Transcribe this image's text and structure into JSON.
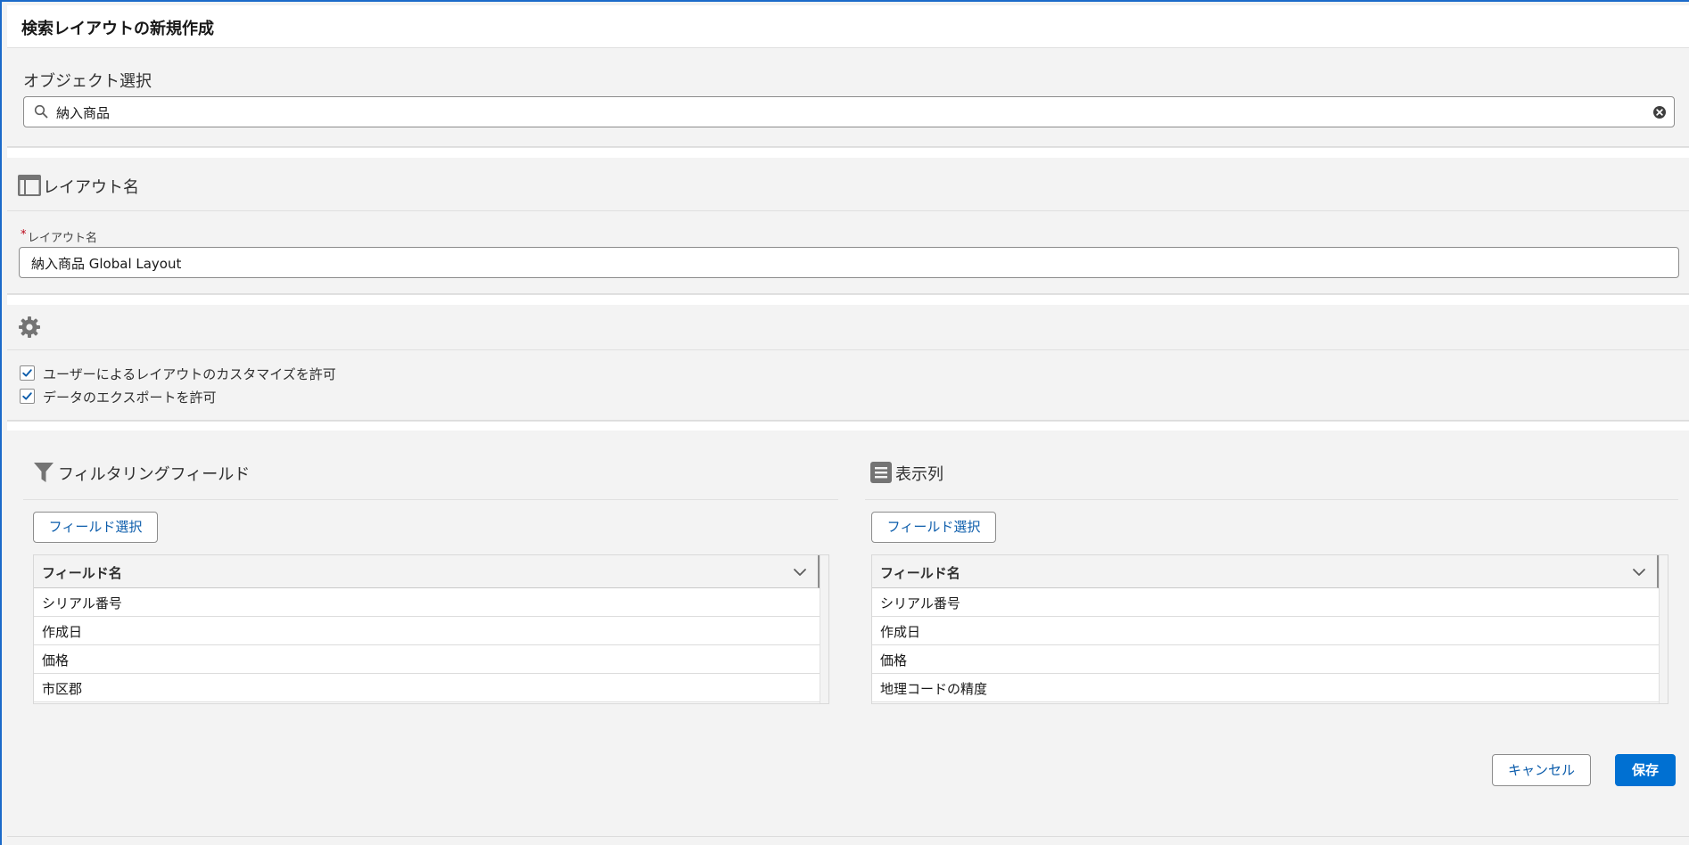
{
  "modal": {
    "title": "検索レイアウトの新規作成"
  },
  "object_select": {
    "label": "オブジェクト選択",
    "search_value": "納入商品"
  },
  "layout_name_section": {
    "heading": "レイアウト名",
    "field_label": "レイアウト名",
    "required_mark": "*",
    "field_value": "納入商品 Global Layout"
  },
  "options": {
    "items": [
      {
        "label": "ユーザーによるレイアウトのカスタマイズを許可",
        "checked": true
      },
      {
        "label": "データのエクスポートを許可",
        "checked": true
      }
    ]
  },
  "filter_fields": {
    "heading": "フィルタリングフィールド",
    "select_button": "フィールド選択",
    "column_header": "フィールド名",
    "rows": [
      "シリアル番号",
      "作成日",
      "価格",
      "市区郡"
    ]
  },
  "display_columns": {
    "heading": "表示列",
    "select_button": "フィールド選択",
    "column_header": "フィールド名",
    "rows": [
      "シリアル番号",
      "作成日",
      "価格",
      "地理コードの精度"
    ]
  },
  "footer": {
    "cancel_label": "キャンセル",
    "save_label": "保存"
  },
  "colors": {
    "brand": "#0070d2",
    "icon_gray": "#747474",
    "required_red": "#ba0517"
  }
}
